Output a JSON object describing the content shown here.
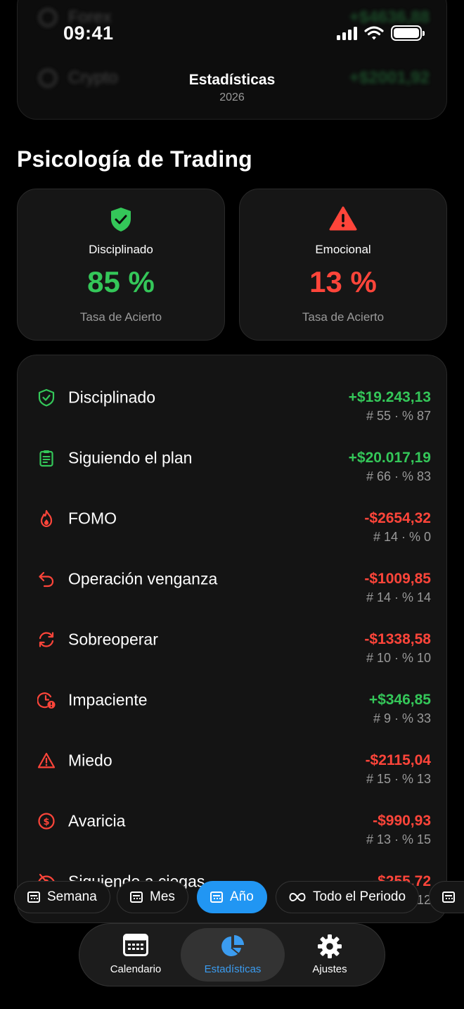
{
  "status_bar": {
    "time": "09:41"
  },
  "background_rows": [
    {
      "name": "Forex",
      "value": "+$4636,88"
    },
    {
      "name": "Crypto",
      "value": "+$2001,92"
    }
  ],
  "header": {
    "title": "Estadísticas",
    "subtitle": "2026"
  },
  "section_title": "Psicología de Trading",
  "summary": [
    {
      "label": "Disciplinado",
      "percent": "85 %",
      "caption": "Tasa de Acierto",
      "color": "#34c759",
      "icon": "shield-check-icon"
    },
    {
      "label": "Emocional",
      "percent": "13 %",
      "caption": "Tasa de Acierto",
      "color": "#ff453a",
      "icon": "warning-triangle-icon"
    }
  ],
  "rows": [
    {
      "name": "Disciplinado",
      "amount": "+$19.243,13",
      "stats": "# 55 · % 87",
      "tone": "pos",
      "icon": "shield-check-icon"
    },
    {
      "name": "Siguiendo el plan",
      "amount": "+$20.017,19",
      "stats": "# 66 · % 83",
      "tone": "pos",
      "icon": "clipboard-icon"
    },
    {
      "name": "FOMO",
      "amount": "-$2654,32",
      "stats": "# 14 · % 0",
      "tone": "neg",
      "icon": "flame-icon"
    },
    {
      "name": "Operación venganza",
      "amount": "-$1009,85",
      "stats": "# 14 · % 14",
      "tone": "neg",
      "icon": "return-arrow-icon"
    },
    {
      "name": "Sobreoperar",
      "amount": "-$1338,58",
      "stats": "# 10 · % 10",
      "tone": "neg",
      "icon": "refresh-icon"
    },
    {
      "name": "Impaciente",
      "amount": "+$346,85",
      "stats": "# 9 · % 33",
      "tone": "pos",
      "icon": "clock-alert-icon"
    },
    {
      "name": "Miedo",
      "amount": "-$2115,04",
      "stats": "# 15 · % 13",
      "tone": "neg",
      "icon": "warning-triangle-icon"
    },
    {
      "name": "Avaricia",
      "amount": "-$990,93",
      "stats": "# 13 · % 15",
      "tone": "neg",
      "icon": "dollar-circle-icon"
    },
    {
      "name": "Siguiendo a ciegas",
      "amount": "-$255,72",
      "stats": "# 8 · % 12",
      "tone": "neg",
      "icon": "eye-off-icon"
    }
  ],
  "periods": [
    {
      "label": "Semana",
      "active": false
    },
    {
      "label": "Mes",
      "active": false
    },
    {
      "label": "Año",
      "active": true
    },
    {
      "label": "Todo el Periodo",
      "active": false
    }
  ],
  "tabs": [
    {
      "label": "Calendario",
      "icon": "calendar-icon",
      "active": false
    },
    {
      "label": "Estadísticas",
      "icon": "pie-chart-icon",
      "active": true
    },
    {
      "label": "Ajustes",
      "icon": "gear-icon",
      "active": false
    }
  ],
  "colors": {
    "positive": "#34c759",
    "negative": "#ff453a",
    "accent": "#2196f3"
  }
}
